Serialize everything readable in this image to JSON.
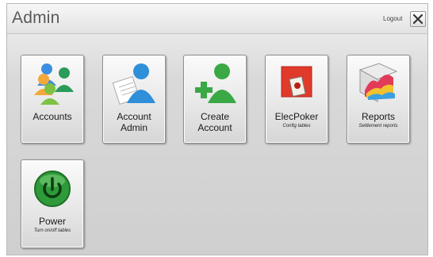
{
  "header": {
    "title": "Admin",
    "logout_label": "Logout"
  },
  "tiles": [
    {
      "label": "Accounts",
      "subtitle": "",
      "icon": "accounts-icon"
    },
    {
      "label_line1": "Account",
      "label_line2": "Admin",
      "subtitle": "",
      "icon": "account-admin-icon"
    },
    {
      "label_line1": "Create",
      "label_line2": "Account",
      "subtitle": "",
      "icon": "create-account-icon"
    },
    {
      "label": "ElecPoker",
      "subtitle": "Config tables",
      "icon": "elecpoker-icon"
    },
    {
      "label": "Reports",
      "subtitle": "Settlement reports",
      "icon": "reports-icon"
    },
    {
      "label": "Power",
      "subtitle": "Turn on/off tables",
      "icon": "power-icon"
    }
  ],
  "colors": {
    "accent_green": "#3aa845",
    "accent_blue": "#2f8fd8",
    "power_green": "#2f9a3a"
  }
}
